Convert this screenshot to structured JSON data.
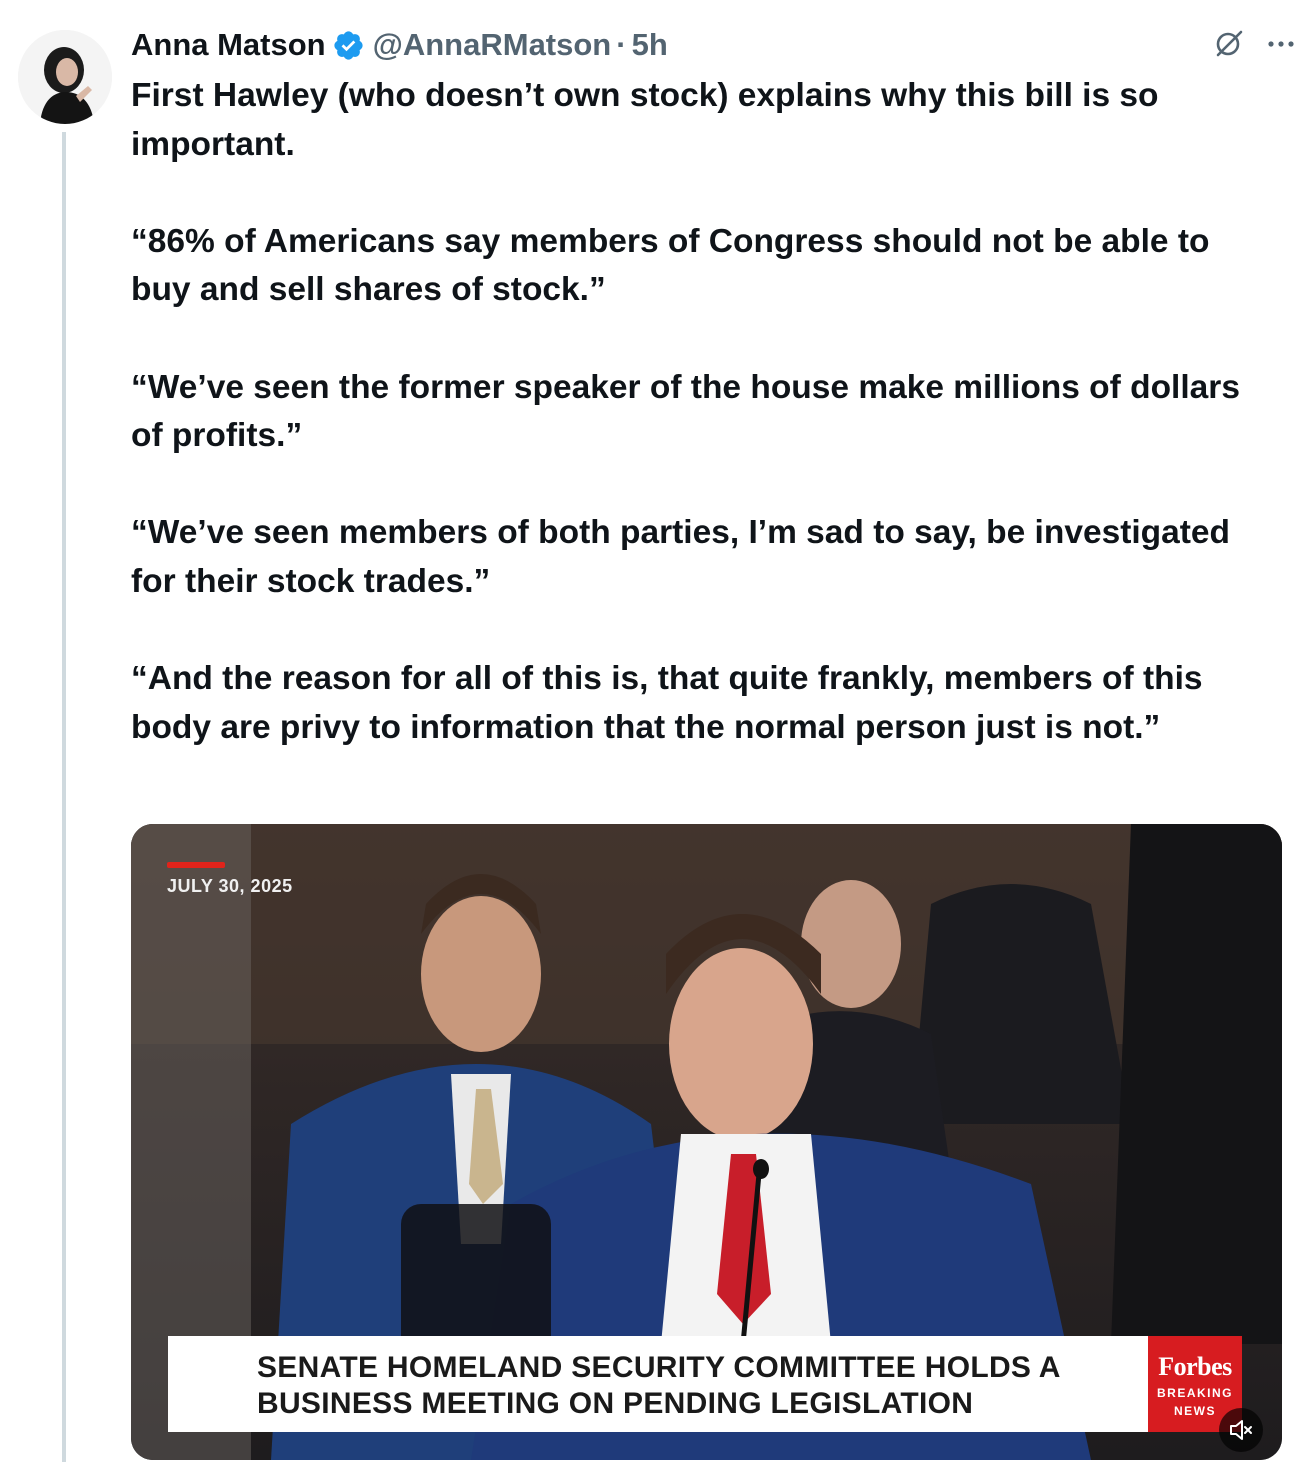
{
  "author": {
    "display_name": "Anna Matson",
    "handle": "@AnnaRMatson",
    "separator": "·",
    "timestamp": "5h",
    "verified_color": "#1d9bf0"
  },
  "tweet": {
    "paragraphs": [
      "First Hawley (who doesn’t own stock) explains why this bill is so important.",
      "“86% of Americans say members of Congress should not be able to buy and sell shares of stock.”",
      "“We’ve seen the former speaker of the house make millions of dollars of profits.”",
      "“We’ve seen members of both parties, I’m sad to say, be investigated for their stock trades.”",
      "“And the reason for all of this is, that quite frankly, members of this body are privy to information that the normal person just is not.”"
    ]
  },
  "top_icons": [
    "grok-icon",
    "more-icon"
  ],
  "media": {
    "type": "video",
    "date_overlay": "JULY 30, 2025",
    "lower_third_line1": "SENATE HOMELAND SECURITY COMMITTEE HOLDS A",
    "lower_third_line2": "BUSINESS MEETING ON PENDING LEGISLATION",
    "brand": "Forbes",
    "brand_sub1": "BREAKING",
    "brand_sub2": "NEWS",
    "brand_color": "#d71c20",
    "mute_icon": "volume-muted-icon"
  }
}
